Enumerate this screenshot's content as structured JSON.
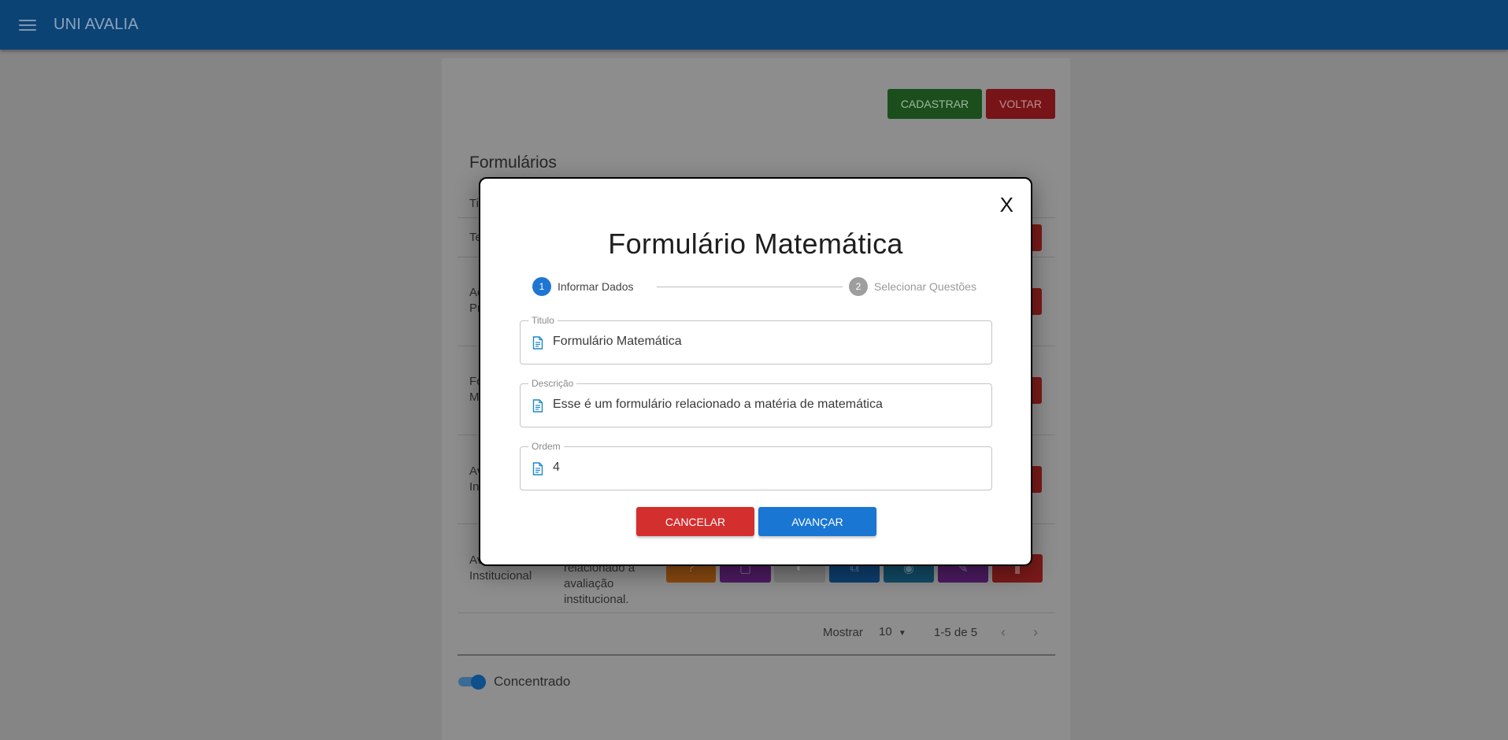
{
  "appbar": {
    "title": "UNI AVALIA",
    "menu_icon": "menu-icon"
  },
  "page": {
    "buttons": {
      "cadastrar": "CADASTRAR",
      "voltar": "VOLTAR"
    },
    "list_title": "Formulários",
    "visible_fragments": {
      "header_col": "Ti",
      "row1": "Te",
      "row2_a": "Ac",
      "row2_b": "Pr",
      "row3_a": "Fo",
      "row3_b": "M",
      "row4_a": "Av",
      "row4_b": "In",
      "row5_name_a": "Av",
      "row5_name_b": "Institucional",
      "row5_desc": [
        "relacionado a",
        "avaliação",
        "institucional."
      ]
    },
    "footer": {
      "mostrar_label": "Mostrar",
      "page_size": "10",
      "range": "1-5 de 5"
    },
    "toggle": {
      "label": "Concentrado",
      "on": true
    },
    "colors": {
      "accent": "#1976d2",
      "danger": "#d32f2f",
      "success": "#2e7d32"
    }
  },
  "modal": {
    "close_label": "X",
    "title": "Formulário Matemática",
    "steps": [
      {
        "number": "1",
        "label": "Informar Dados",
        "active": true
      },
      {
        "number": "2",
        "label": "Selecionar Questões",
        "active": false
      }
    ],
    "fields": {
      "titulo": {
        "label": "Titulo",
        "value": "Formulário Matemática",
        "icon": "document-icon"
      },
      "descricao": {
        "label": "Descrição",
        "value": "Esse é um formulário relacionado a matéria de matemática",
        "icon": "document-icon"
      },
      "ordem": {
        "label": "Ordem",
        "value": "4",
        "icon": "document-icon"
      }
    },
    "buttons": {
      "cancelar": "CANCELAR",
      "avancar": "AVANÇAR"
    }
  }
}
